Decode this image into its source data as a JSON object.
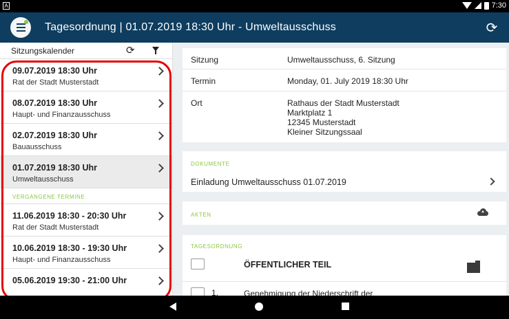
{
  "status_bar": {
    "time": "7:30",
    "notification_icon": "android-notification-icon"
  },
  "appbar": {
    "title": "Tagesordnung | 01.07.2019 18:30 Uhr - Umweltausschuss",
    "refresh_glyph": "⟳"
  },
  "calendar": {
    "header": "Sitzungskalender",
    "refresh_glyph": "⟳",
    "upcoming": [
      {
        "date": "09.07.2019 18:30 Uhr",
        "body": "Rat der Stadt Musterstadt",
        "selected": false
      },
      {
        "date": "08.07.2019 18:30 Uhr",
        "body": "Haupt- und Finanzausschuss",
        "selected": false
      },
      {
        "date": "02.07.2019 18:30 Uhr",
        "body": "Bauausschuss",
        "selected": false
      },
      {
        "date": "01.07.2019 18:30 Uhr",
        "body": "Umweltausschuss",
        "selected": true
      }
    ],
    "past_label": "VERGANGENE TERMINE",
    "past": [
      {
        "date": "11.06.2019 18:30 - 20:30 Uhr",
        "body": "Rat der Stadt Musterstadt"
      },
      {
        "date": "10.06.2019 18:30 - 19:30 Uhr",
        "body": "Haupt- und Finanzausschuss"
      },
      {
        "date": "05.06.2019 19:30 - 21:00 Uhr",
        "body": ""
      }
    ]
  },
  "details": {
    "sitzung_label": "Sitzung",
    "sitzung_value": "Umweltausschuss, 6. Sitzung",
    "termin_label": "Termin",
    "termin_value": "Monday, 01. July 2019 18:30 Uhr",
    "ort_label": "Ort",
    "ort_lines": [
      "Rathaus der Stadt Musterstadt",
      "Marktplatz 1",
      "12345 Musterstadt",
      "Kleiner Sitzungssaal"
    ]
  },
  "documents": {
    "label": "DOKUMENTE",
    "items": [
      "Einladung Umweltausschuss 01.07.2019"
    ]
  },
  "akten": {
    "label": "AKTEN"
  },
  "agenda": {
    "label": "TAGESORDNUNG",
    "section_title": "ÖFFENTLICHER TEIL",
    "items": [
      {
        "number": "1.",
        "title": "Genehmigung der Niederschrift der"
      }
    ]
  },
  "colors": {
    "appbar": "#0e3d5f",
    "accent_green": "#8dc63f",
    "highlight_red": "#e50000"
  }
}
